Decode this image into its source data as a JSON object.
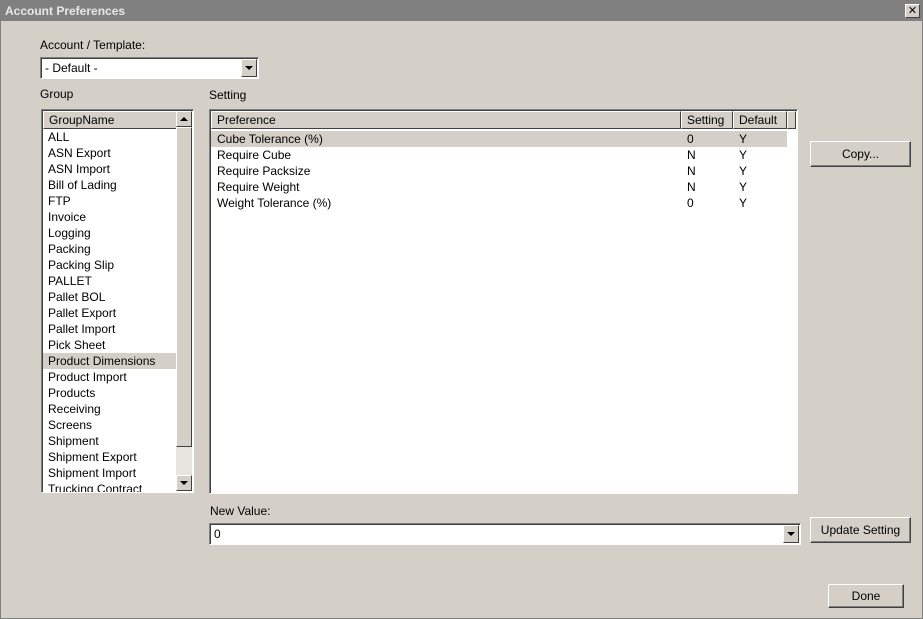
{
  "window": {
    "title": "Account Preferences"
  },
  "account": {
    "label": "Account / Template:",
    "selected": "- Default -"
  },
  "group": {
    "label": "Group",
    "column_header": "GroupName",
    "items": [
      {
        "label": "ALL",
        "selected": false
      },
      {
        "label": "ASN Export",
        "selected": false
      },
      {
        "label": "ASN Import",
        "selected": false
      },
      {
        "label": "Bill of Lading",
        "selected": false
      },
      {
        "label": "FTP",
        "selected": false
      },
      {
        "label": "Invoice",
        "selected": false
      },
      {
        "label": "Logging",
        "selected": false
      },
      {
        "label": "Packing",
        "selected": false
      },
      {
        "label": "Packing Slip",
        "selected": false
      },
      {
        "label": "PALLET",
        "selected": false
      },
      {
        "label": "Pallet BOL",
        "selected": false
      },
      {
        "label": "Pallet Export",
        "selected": false
      },
      {
        "label": "Pallet Import",
        "selected": false
      },
      {
        "label": "Pick Sheet",
        "selected": false
      },
      {
        "label": "Product Dimensions",
        "selected": true
      },
      {
        "label": "Product Import",
        "selected": false
      },
      {
        "label": "Products",
        "selected": false
      },
      {
        "label": "Receiving",
        "selected": false
      },
      {
        "label": "Screens",
        "selected": false
      },
      {
        "label": "Shipment",
        "selected": false
      },
      {
        "label": "Shipment Export",
        "selected": false
      },
      {
        "label": "Shipment Import",
        "selected": false
      },
      {
        "label": "Trucking Contract",
        "selected": false
      }
    ]
  },
  "setting": {
    "label": "Setting",
    "columns": {
      "preference": "Preference",
      "setting": "Setting",
      "default": "Default"
    },
    "rows": [
      {
        "preference": "Cube Tolerance (%)",
        "setting": "0",
        "default": "Y",
        "selected": true
      },
      {
        "preference": "Require Cube",
        "setting": "N",
        "default": "Y",
        "selected": false
      },
      {
        "preference": "Require Packsize",
        "setting": "N",
        "default": "Y",
        "selected": false
      },
      {
        "preference": "Require Weight",
        "setting": "N",
        "default": "Y",
        "selected": false
      },
      {
        "preference": "Weight Tolerance (%)",
        "setting": "0",
        "default": "Y",
        "selected": false
      }
    ]
  },
  "new_value": {
    "label": "New Value:",
    "value": "0"
  },
  "buttons": {
    "copy": "Copy...",
    "update": "Update Setting",
    "done": "Done"
  }
}
